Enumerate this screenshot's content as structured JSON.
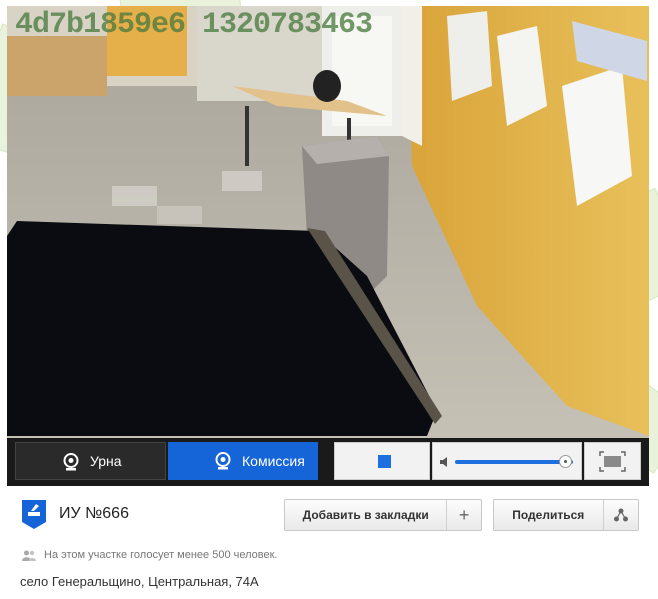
{
  "video": {
    "watermark": "4d7b1859e6 1320783463"
  },
  "player_controls": {
    "cameras": [
      {
        "label": "Урна",
        "active": false,
        "icon": "webcam-icon"
      },
      {
        "label": "Комиссия",
        "active": true,
        "icon": "webcam-icon"
      }
    ],
    "stop_icon": "stop-icon",
    "volume_icon": "speaker-icon",
    "volume_level": 1.0,
    "fullscreen_icon": "fullscreen-icon"
  },
  "station": {
    "icon": "ballot-box-icon",
    "title": "ИУ №666",
    "bookmark_label": "Добавить в закладки",
    "bookmark_plus": "+",
    "share_label": "Поделиться",
    "share_icon": "share-icon",
    "voters_icon": "people-icon",
    "voters_note": "На этом участке голосует менее 500 человек.",
    "address": "село Генеральщино, Центральная, 74А"
  },
  "colors": {
    "accent": "#1565d8",
    "control_bar": "#1a1a1a"
  }
}
